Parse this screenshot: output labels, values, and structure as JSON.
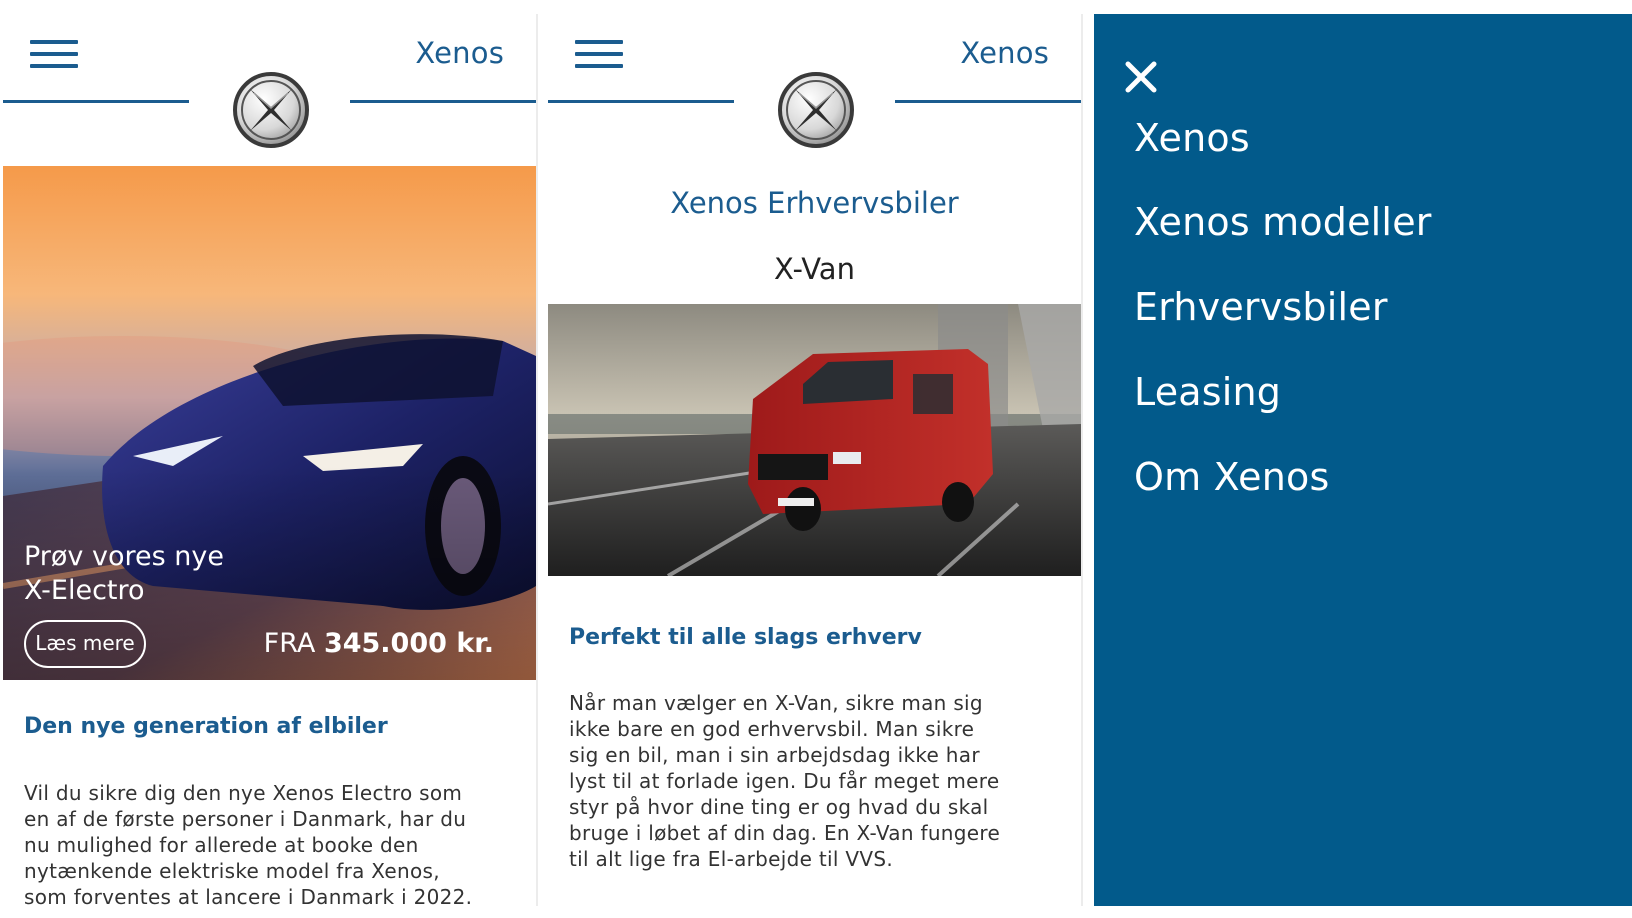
{
  "colors": {
    "brand_blue": "#1b5c8f",
    "menu_bg": "#025a8b",
    "white": "#ffffff"
  },
  "screen1": {
    "menu_icon": "hamburger-icon",
    "brand": "Xenos",
    "logo_icon": "xenos-logo",
    "hero": {
      "title_line1": "Prøv vores nye",
      "title_line2": "X-Electro",
      "button": "Læs mere",
      "price_prefix": "FRA",
      "price_value": "345.000 kr."
    },
    "section_title": "Den nye generation af elbiler",
    "body": "Vil du sikre dig den nye Xenos Electro som en af de første personer i Danmark, har du nu mulighed for allerede at booke den nytænkende elektriske model fra Xenos, som forventes at lancere i Danmark i 2022."
  },
  "screen2": {
    "menu_icon": "hamburger-icon",
    "brand": "Xenos",
    "logo_icon": "xenos-logo",
    "heading": "Xenos Erhvervsbiler",
    "model": "X-Van",
    "section_title": "Perfekt til alle slags erhverv",
    "body": "Når man vælger en X-Van, sikre man sig ikke bare en god erhvervsbil. Man sikre sig en bil, man i sin arbejdsdag ikke har lyst til at forlade igen. Du får meget mere styr på hvor dine ting er og hvad du skal bruge i løbet af din dag. En X-Van fungere til alt lige fra El-arbejde til VVS."
  },
  "screen3": {
    "close_icon": "close-icon",
    "menu_items": [
      "Xenos",
      "Xenos modeller",
      "Erhvervsbiler",
      "Leasing",
      "Om Xenos"
    ]
  }
}
